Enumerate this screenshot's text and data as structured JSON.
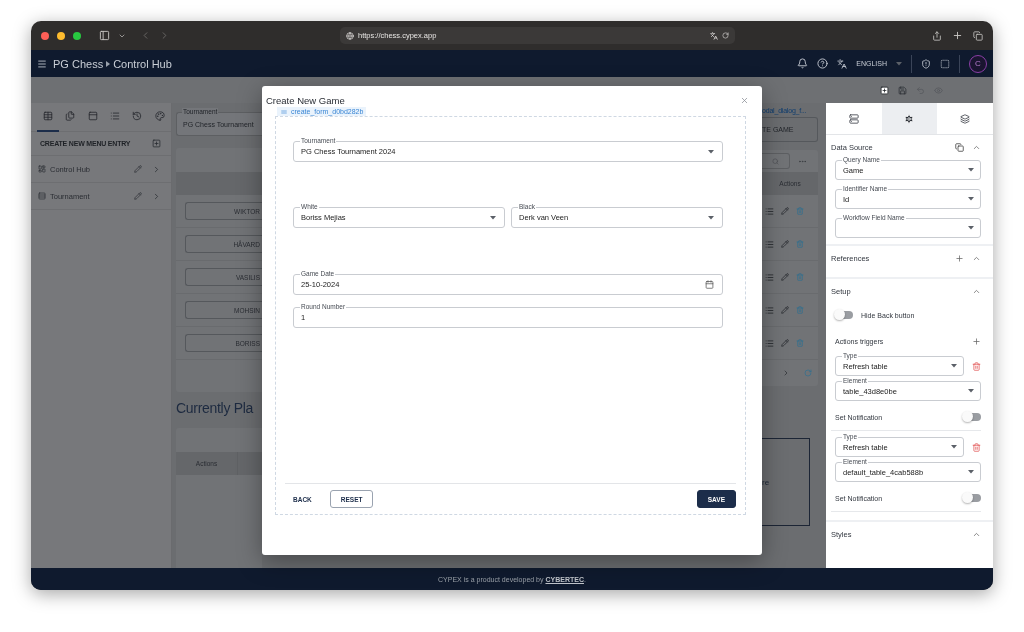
{
  "browser": {
    "url": "https://chess.cypex.app"
  },
  "header": {
    "breadcrumb": [
      "PG Chess",
      "Control Hub"
    ],
    "language": "ENGLISH",
    "avatar": "C"
  },
  "sidebar": {
    "tabs": [
      {
        "selected": true
      },
      {
        "selected": false
      },
      {
        "selected": false
      },
      {
        "selected": false
      },
      {
        "selected": false
      },
      {
        "selected": false
      }
    ],
    "create_label": "CREATE NEW MENU ENTRY",
    "items": [
      {
        "label": "Control Hub",
        "kind": "dashboard"
      },
      {
        "label": "Tournament",
        "kind": "table"
      }
    ]
  },
  "canvas": {
    "field_label": "Tournament",
    "field_value": "PG Chess Tournament",
    "element_name": "odal_dialog_f...",
    "create_button": "TE GAME",
    "rows": [
      {
        "player": "WIKTOR"
      },
      {
        "player": "HÅVARD"
      },
      {
        "player": "VASILIS"
      },
      {
        "player": "MOHSIN"
      },
      {
        "player": "BORISS"
      }
    ],
    "column": "Actions",
    "heading": "Currently Pla",
    "second_column": "Actions",
    "box_text": "re"
  },
  "modal": {
    "title": "Create New Game",
    "form_name": "create_form_d0bd282b",
    "rows": [
      [
        {
          "label": "Tournament",
          "value": "PG Chess Tournament 2024",
          "kind": "select"
        }
      ],
      [
        {
          "label": "White",
          "value": "Boriss Mejias",
          "kind": "select"
        },
        {
          "label": "Black",
          "value": "Derk van Veen",
          "kind": "select"
        }
      ],
      [
        {
          "label": "Game Date",
          "value": "25-10-2024",
          "kind": "date"
        }
      ],
      [
        {
          "label": "Round Number",
          "value": "1",
          "kind": "text"
        }
      ]
    ],
    "buttons": [
      {
        "label": "BACK",
        "kind": "text"
      },
      {
        "label": "RESET",
        "kind": "outlined"
      },
      {
        "label": "SAVE",
        "kind": "primary"
      }
    ]
  },
  "panel": {
    "tabs": [
      {
        "selected": false
      },
      {
        "selected": true
      },
      {
        "selected": false
      }
    ],
    "data_source": {
      "title": "Data Source",
      "expanded": true,
      "fields": [
        {
          "label": "Query Name",
          "value": "Game"
        },
        {
          "label": "Identifier Name",
          "value": "Id"
        },
        {
          "label": "Workflow Field Name"
        }
      ]
    },
    "references": {
      "title": "References",
      "expanded": true
    },
    "setup": {
      "title": "Setup",
      "expanded": true,
      "hide_back": {
        "label": "Hide Back button",
        "on": false
      },
      "triggers_title": "Actions triggers",
      "triggers": [
        {
          "type_label": "Type",
          "type": "Refresh table",
          "element_label": "Element",
          "element": "table_43d8e0be",
          "notification_label": "Set Notification",
          "notification": false
        },
        {
          "type_label": "Type",
          "type": "Refresh table",
          "element_label": "Element",
          "element": "default_table_4cab588b",
          "notification_label": "Set Notification",
          "notification": false
        }
      ]
    },
    "styles": {
      "title": "Styles",
      "expanded": true
    }
  },
  "footer": {
    "text": "CYPEX is a product developed by ",
    "link": "CYBERTEC",
    "end": "."
  }
}
